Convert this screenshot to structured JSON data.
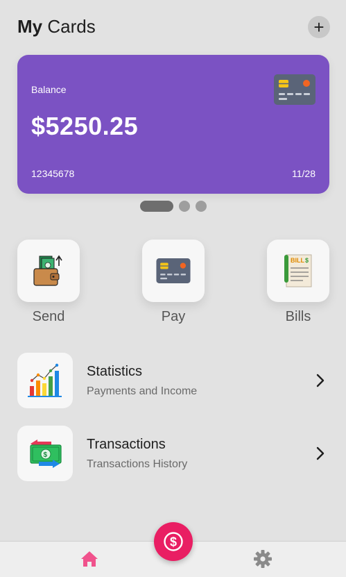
{
  "header": {
    "title_bold": "My",
    "title_rest": "Cards",
    "add_icon": "plus-icon"
  },
  "card": {
    "balance_label": "Balance",
    "balance": "$5250.25",
    "number": "12345678",
    "expiry": "11/28",
    "background": "#7b52c3",
    "icon": "credit-card-icon"
  },
  "pager": {
    "count": 3,
    "active_index": 0
  },
  "actions": [
    {
      "label": "Send",
      "icon": "wallet-money-icon"
    },
    {
      "label": "Pay",
      "icon": "credit-card-icon"
    },
    {
      "label": "Bills",
      "icon": "bill-receipt-icon"
    }
  ],
  "rows": [
    {
      "title": "Statistics",
      "subtitle": "Payments and Income",
      "icon": "bar-chart-icon"
    },
    {
      "title": "Transactions",
      "subtitle": "Transactions History",
      "icon": "money-exchange-icon"
    }
  ],
  "bottom_nav": {
    "home_icon": "home-icon",
    "fab_icon": "dollar-icon",
    "settings_icon": "gear-icon",
    "accent": "#e91e63",
    "home_color": "#f0528c"
  }
}
